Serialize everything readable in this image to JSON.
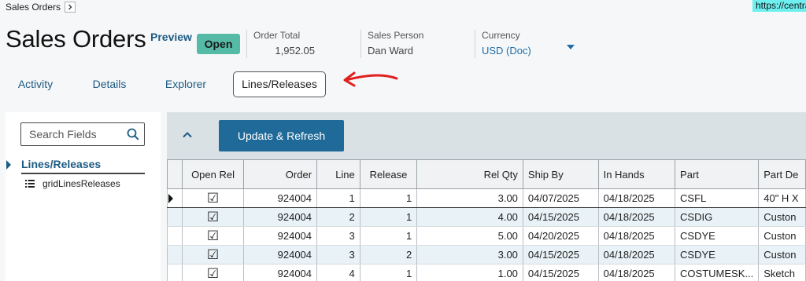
{
  "breadcrumb": {
    "label": "Sales Orders"
  },
  "url_chip": "https://centra",
  "header": {
    "title": "Sales Orders",
    "preview_label": "Preview",
    "status": "Open",
    "order_total_label": "Order Total",
    "order_total_value": "1,952.05",
    "sales_person_label": "Sales Person",
    "sales_person_value": "Dan Ward",
    "currency_label": "Currency",
    "currency_value": "USD (Doc)"
  },
  "tabs": [
    {
      "label": "Activity"
    },
    {
      "label": "Details"
    },
    {
      "label": "Explorer"
    },
    {
      "label": "Lines/Releases",
      "active": true
    }
  ],
  "sidebar": {
    "search_placeholder": "Search Fields",
    "tree_root": "Lines/Releases",
    "tree_child": "gridLinesReleases"
  },
  "toolbar": {
    "update_label": "Update & Refresh"
  },
  "grid": {
    "columns": [
      "Open Rel",
      "Order",
      "Line",
      "Release",
      "Rel Qty",
      "Ship By",
      "In Hands",
      "Part",
      "Part De"
    ],
    "rows": [
      {
        "open_rel": "☑",
        "order": "924004",
        "line": "1",
        "release": "1",
        "rel_qty": "3.00",
        "ship_by": "04/07/2025",
        "in_hands": "04/18/2025",
        "part": "CSFL",
        "part_desc": "40\" H X"
      },
      {
        "open_rel": "☑",
        "order": "924004",
        "line": "2",
        "release": "1",
        "rel_qty": "4.00",
        "ship_by": "04/15/2025",
        "in_hands": "04/18/2025",
        "part": "CSDIG",
        "part_desc": "Custon"
      },
      {
        "open_rel": "☑",
        "order": "924004",
        "line": "3",
        "release": "1",
        "rel_qty": "5.00",
        "ship_by": "04/20/2025",
        "in_hands": "04/18/2025",
        "part": "CSDYE",
        "part_desc": "Custon"
      },
      {
        "open_rel": "☑",
        "order": "924004",
        "line": "3",
        "release": "2",
        "rel_qty": "3.00",
        "ship_by": "04/15/2025",
        "in_hands": "04/18/2025",
        "part": "CSDYE",
        "part_desc": "Custon"
      },
      {
        "open_rel": "☑",
        "order": "924004",
        "line": "4",
        "release": "1",
        "rel_qty": "1.00",
        "ship_by": "04/15/2025",
        "in_hands": "04/18/2025",
        "part": "COSTUMESK...",
        "part_desc": "Sketch"
      }
    ]
  },
  "colors": {
    "accent": "#1d5b83",
    "status_open": "#56bba6",
    "primary_button": "#1f6a99",
    "annotation_arrow": "#e02020"
  }
}
